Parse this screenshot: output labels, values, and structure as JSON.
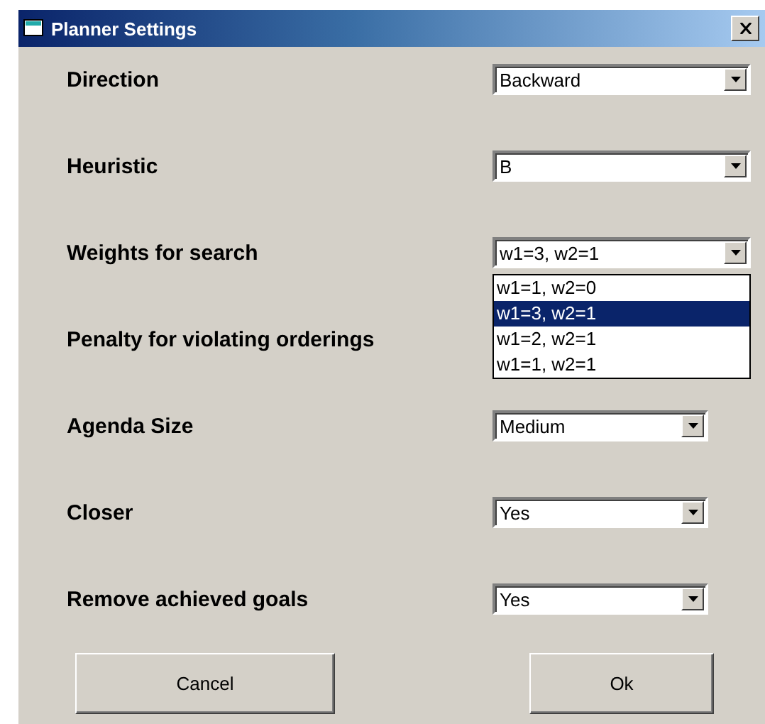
{
  "window": {
    "title": "Planner Settings"
  },
  "settings": [
    {
      "label": "Direction",
      "kind": "wide",
      "value": "Backward"
    },
    {
      "label": "Heuristic",
      "kind": "wide",
      "value": "B"
    },
    {
      "label": "Weights for search",
      "kind": "wide",
      "value": "w1=3, w2=1",
      "expanded": true,
      "options": [
        {
          "label": "w1=1, w2=0",
          "selected": false
        },
        {
          "label": "w1=3, w2=1",
          "selected": true
        },
        {
          "label": "w1=2, w2=1",
          "selected": false
        },
        {
          "label": "w1=1, w2=1",
          "selected": false
        }
      ]
    },
    {
      "label": "Penalty for violating orderings",
      "kind": "covered"
    },
    {
      "label": "Agenda Size",
      "kind": "narrow",
      "value": "Medium"
    },
    {
      "label": "Closer",
      "kind": "narrow",
      "value": "Yes"
    },
    {
      "label": "Remove achieved goals",
      "kind": "narrow",
      "value": "Yes"
    }
  ],
  "buttons": [
    "Cancel",
    "Ok"
  ]
}
